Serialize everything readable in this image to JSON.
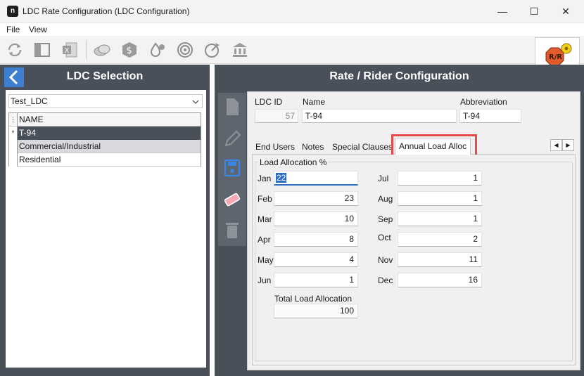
{
  "window": {
    "title": "LDC Rate Configuration (LDC Configuration)",
    "minimize": "—",
    "maximize": "☐",
    "close": "✕"
  },
  "menu": [
    "File",
    "View"
  ],
  "toolbar": {
    "icons": [
      "refresh-icon",
      "panel-icon",
      "excel-icon",
      "coins-icon",
      "dollar-hex-icon",
      "gas-settings-icon",
      "target-icon",
      "gauge-icon",
      "bank-icon"
    ]
  },
  "left": {
    "title": "LDC Selection",
    "select_value": "Test_LDC",
    "grid_header": "NAME",
    "rows": [
      {
        "marker": "*",
        "name": "T-94"
      },
      {
        "marker": "",
        "name": "Commercial/Industrial"
      },
      {
        "marker": "",
        "name": "Residential"
      }
    ]
  },
  "right": {
    "title": "Rate / Rider Configuration",
    "ldc_id_label": "LDC ID",
    "ldc_id_value": "57",
    "name_label": "Name",
    "name_value": "T-94",
    "abbr_label": "Abbreviation",
    "abbr_value": "T-94",
    "tabs": [
      "End Users",
      "Notes",
      "Special Clauses",
      "Annual Load Alloc"
    ],
    "active_tab": "Annual Load Alloc",
    "group_title": "Load Allocation %",
    "months_left": [
      {
        "label": "Jan",
        "value": "22"
      },
      {
        "label": "Feb",
        "value": "23"
      },
      {
        "label": "Mar",
        "value": "10"
      },
      {
        "label": "Apr",
        "value": "8"
      },
      {
        "label": "May",
        "value": "4"
      },
      {
        "label": "Jun",
        "value": "1"
      }
    ],
    "months_right": [
      {
        "label": "Jul",
        "value": "1"
      },
      {
        "label": "Aug",
        "value": "1"
      },
      {
        "label": "Sep",
        "value": "1"
      },
      {
        "label": "Oct",
        "value": "2"
      },
      {
        "label": "Nov",
        "value": "11"
      },
      {
        "label": "Dec",
        "value": "16"
      }
    ],
    "total_label": "Total Load Allocation",
    "total_value": "100"
  },
  "colors": {
    "panel": "#49505a",
    "accent_blue": "#3d7fd1",
    "highlight_red": "#e8474c"
  }
}
